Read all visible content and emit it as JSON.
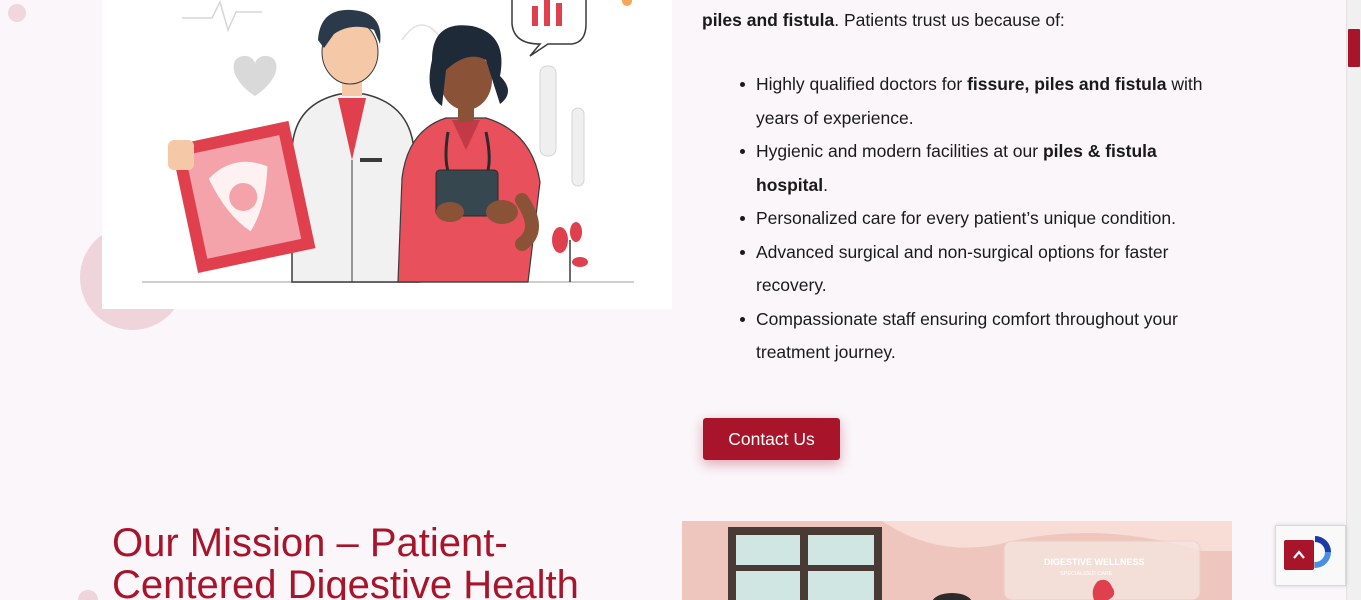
{
  "intro": {
    "bold_lead": "piles and fistula",
    "rest": ". Patients trust us because of:"
  },
  "bullets": [
    {
      "pre": "Highly qualified doctors for ",
      "bold": "fissure, piles and fistula",
      "post": " with years of experience."
    },
    {
      "pre": "Hygienic and modern facilities at our ",
      "bold": "piles & fistula hospital",
      "post": "."
    },
    {
      "pre": "Personalized care for every patient’s unique condition.",
      "bold": "",
      "post": ""
    },
    {
      "pre": "Advanced surgical and non-surgical options for faster recovery.",
      "bold": "",
      "post": ""
    },
    {
      "pre": "Compassionate staff ensuring comfort throughout your treatment journey.",
      "bold": "",
      "post": ""
    }
  ],
  "contact_button": "Contact Us",
  "mission_heading": "Our Mission – Patient-Centered Digestive Health",
  "mission_image_text": {
    "line1": "DIGESTIVE WELLNESS",
    "line2": "SPECIALIZED CARE"
  },
  "icons": {
    "back_to_top": "chevron-up-icon",
    "recaptcha": "recaptcha-icon"
  },
  "colors": {
    "brand": "#a8142a",
    "background": "#faf6fa"
  }
}
